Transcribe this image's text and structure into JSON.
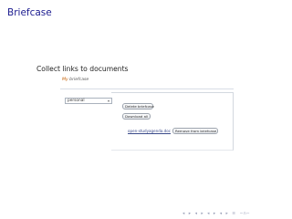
{
  "slide": {
    "frame_title": "Briefcase",
    "subtitle": "Collect links to documents"
  },
  "screenshot": {
    "logo_prefix": "My",
    "logo_suffix": "briefcase",
    "dropdown_value": "personal",
    "buttons": {
      "delete": "Delete briefcase",
      "download": "Download all",
      "remove": "Remove from briefcase"
    },
    "file_link": "open-studyagenda.doc"
  },
  "nav": {
    "icons": [
      "◂",
      "▸",
      "◂",
      "▸",
      "◂",
      "▸",
      "◂",
      "▸",
      "≡",
      "∽∩∽"
    ]
  }
}
